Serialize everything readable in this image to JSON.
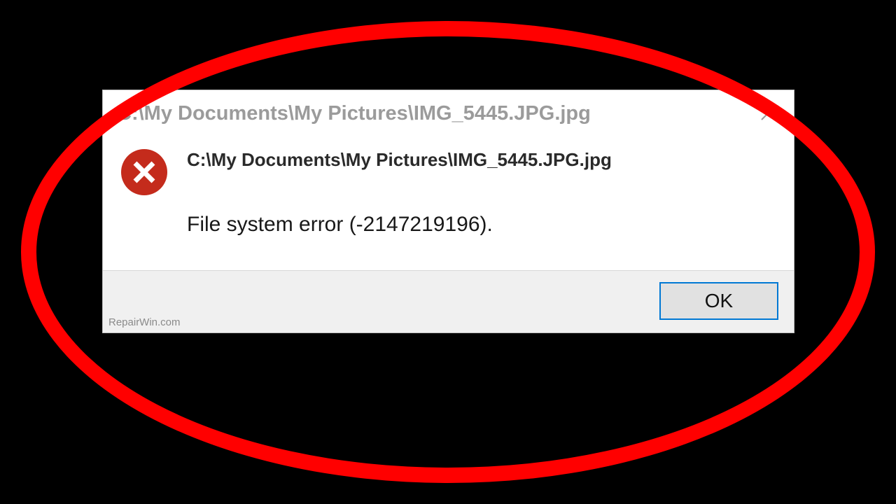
{
  "dialog": {
    "title": "C:\\My Documents\\My Pictures\\IMG_5445.JPG.jpg",
    "primary_message": "C:\\My Documents\\My Pictures\\IMG_5445.JPG.jpg",
    "secondary_message": "File system error (-2147219196).",
    "ok_label": "OK"
  },
  "watermark": "RepairWin.com",
  "colors": {
    "error_icon": "#c42b1c",
    "accent": "#0078d4",
    "highlight_ring": "#ff0000"
  }
}
